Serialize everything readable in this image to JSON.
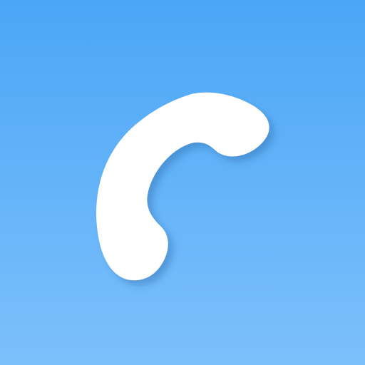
{
  "icon": {
    "name": "phone-handset-icon",
    "background_top": "#4BA6F6",
    "background_bottom": "#7CC0FB",
    "glyph_color": "#FFFFFF",
    "shadow_color": "#2E6FAE"
  }
}
